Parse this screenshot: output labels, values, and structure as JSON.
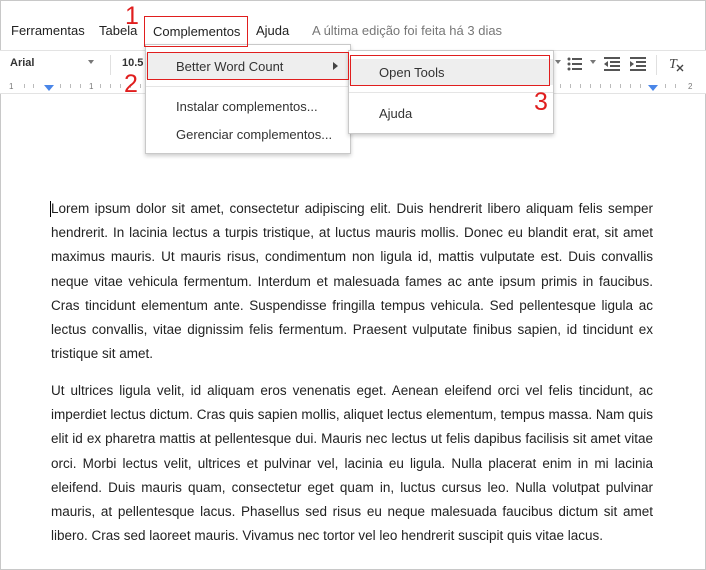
{
  "menubar": {
    "items": [
      "Ferramentas",
      "Tabela",
      "Complementos",
      "Ajuda"
    ],
    "last_edit": "A última edição foi feita há 3 dias"
  },
  "toolbar": {
    "font": "Arial",
    "size": "10.5",
    "icons": [
      "line-spacing-icon",
      "bulleted-list-icon",
      "decrease-indent-icon",
      "clear-formatting-icon"
    ]
  },
  "ruler": {
    "numbers": [
      "1",
      "1",
      "2"
    ]
  },
  "addons_menu": {
    "items": [
      "Better Word Count",
      "Instalar complementos...",
      "Gerenciar complementos..."
    ]
  },
  "submenu": {
    "items": [
      "Open Tools",
      "Ajuda"
    ]
  },
  "annotations": {
    "step1": "1",
    "step2": "2",
    "step3": "3"
  },
  "annotation_color": "#e01e1e",
  "document": {
    "paragraph1": "Lorem ipsum dolor sit amet, consectetur adipiscing elit. Duis hendrerit libero aliquam felis semper hendrerit. In lacinia lectus a turpis tristique, at luctus mauris mollis. Donec eu blandit erat, sit amet maximus mauris. Ut mauris risus, condimentum non ligula id, mattis vulputate est. Duis convallis neque vitae vehicula fermentum. Interdum et malesuada fames ac ante ipsum primis in faucibus. Cras tincidunt elementum ante. Suspendisse fringilla tempus vehicula. Sed pellentesque ligula ac lectus convallis, vitae dignissim felis fermentum. Praesent vulputate finibus sapien, id tincidunt ex tristique sit amet.",
    "paragraph2": "Ut ultrices ligula velit, id aliquam eros venenatis eget. Aenean eleifend orci vel felis tincidunt, ac imperdiet lectus dictum. Cras quis sapien mollis, aliquet lectus elementum, tempus massa. Nam quis elit id ex pharetra mattis at pellentesque dui. Mauris nec lectus ut felis dapibus facilisis sit amet vitae orci. Morbi lectus velit, ultrices et pulvinar vel, lacinia eu ligula. Nulla placerat enim in mi lacinia eleifend. Duis mauris quam, consectetur eget quam in, luctus cursus leo. Nulla volutpat pulvinar mauris, at pellentesque lacus. Phasellus sed risus eu neque malesuada faucibus dictum sit amet libero. Cras sed laoreet mauris. Vivamus nec tortor vel leo hendrerit suscipit quis vitae lacus."
  }
}
